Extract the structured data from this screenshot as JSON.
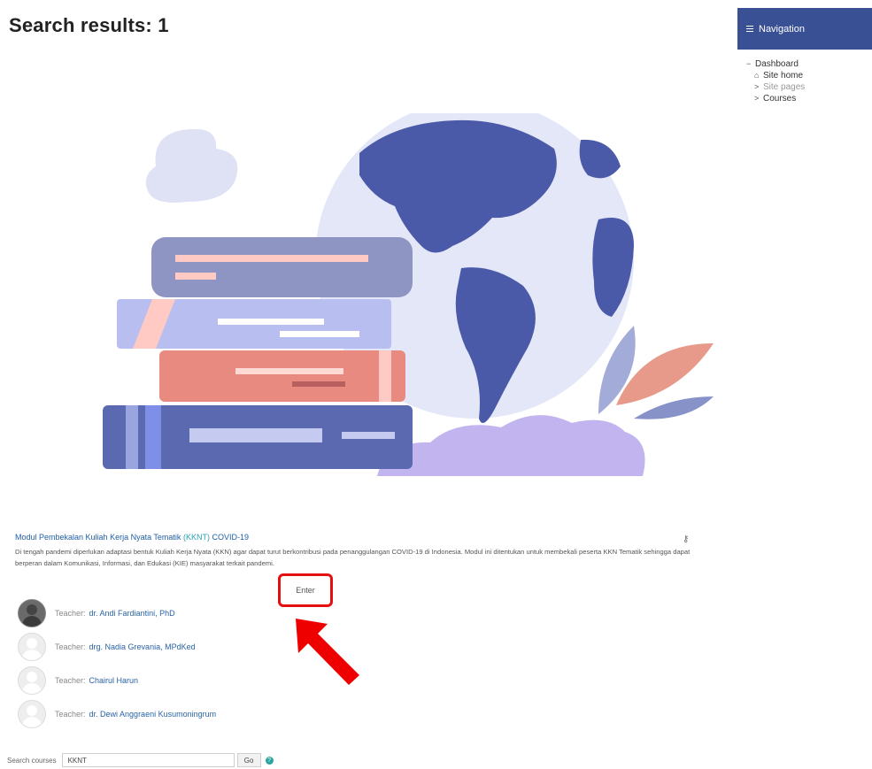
{
  "page": {
    "title": "Search results: 1"
  },
  "navigation": {
    "header": "Navigation",
    "items": [
      {
        "label": "Dashboard",
        "marker": "−"
      },
      {
        "label": "Site home",
        "marker": "home-icon"
      },
      {
        "label": "Site pages",
        "marker": ">"
      },
      {
        "label": "Courses",
        "marker": ">"
      }
    ]
  },
  "course": {
    "title_prefix": "Modul Pembekalan Kuliah Kerja Nyata Tematik",
    "title_highlight": "(KKNT)",
    "title_suffix": "COVID-19",
    "summary": "Di tengah pandemi diperlukan adaptasi bentuk Kuliah Kerja Nyata (KKN) agar dapat turut berkontribusi pada penanggulangan COVID-19 di Indonesia. Modul ini ditentukan untuk membekali peserta KKN Tematik sehingga dapat berperan dalam Komunikasi, Informasi, dan Edukasi (KIE) masyarakat terkait pandemi.",
    "enter_label": "Enter",
    "teacher_role": "Teacher:",
    "teachers": [
      "dr. Andi Fardiantini, PhD",
      "drg. Nadia Grevania, MPdKed",
      "Chairul Harun",
      "dr. Dewi Anggraeni Kusumoningrum"
    ]
  },
  "search": {
    "label": "Search courses",
    "value": "KKNT",
    "go_label": "Go",
    "help": "?"
  },
  "colors": {
    "nav_header": "#3a5094",
    "highlight_box": "#e41010",
    "link": "#2a63a8"
  }
}
